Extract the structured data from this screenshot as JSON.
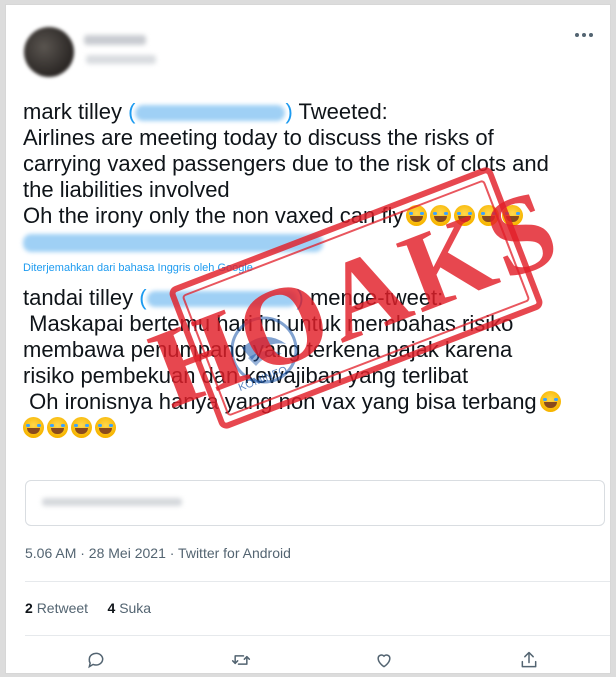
{
  "tweet": {
    "line1_name": "mark tilley",
    "line1_suffix": "Tweeted:",
    "line2": "Airlines are meeting today to discuss the risks of",
    "line3": "carrying vaxed passengers due to the risk of clots and",
    "line4": "the liabilities involved",
    "line5": "Oh the irony only the non vaxed can fly",
    "translated_by": "Diterjemahkan dari bahasa Inggris oleh Google",
    "tr_line1_name": "tandai tilley",
    "tr_line1_suffix": "menge-tweet:",
    "tr_line2": " Maskapai bertemu hari ini untuk membahas risiko",
    "tr_line3": "membawa penumpang yang terkena pajak karena",
    "tr_line4": "risiko pembekuan dan kewajiban yang terlibat",
    "tr_line5": " Oh ironisnya hanya yang non vax yang bisa terbang"
  },
  "meta": {
    "timestamp": "5.06 AM · 28 Mei 2021 · Twitter for Android"
  },
  "stats": {
    "retweet_count": "2",
    "retweet_label": "Retweet",
    "like_count": "4",
    "like_label": "Suka"
  },
  "stamp": {
    "text": "HOAKS",
    "logo_text": "KOMINFO",
    "color": "#e21e28"
  },
  "icons": [
    "more-icon",
    "reply-icon",
    "retweet-icon",
    "like-icon",
    "share-icon"
  ],
  "colors": {
    "link": "#1d9bf0",
    "text": "#0f1419",
    "muted": "#536471"
  }
}
